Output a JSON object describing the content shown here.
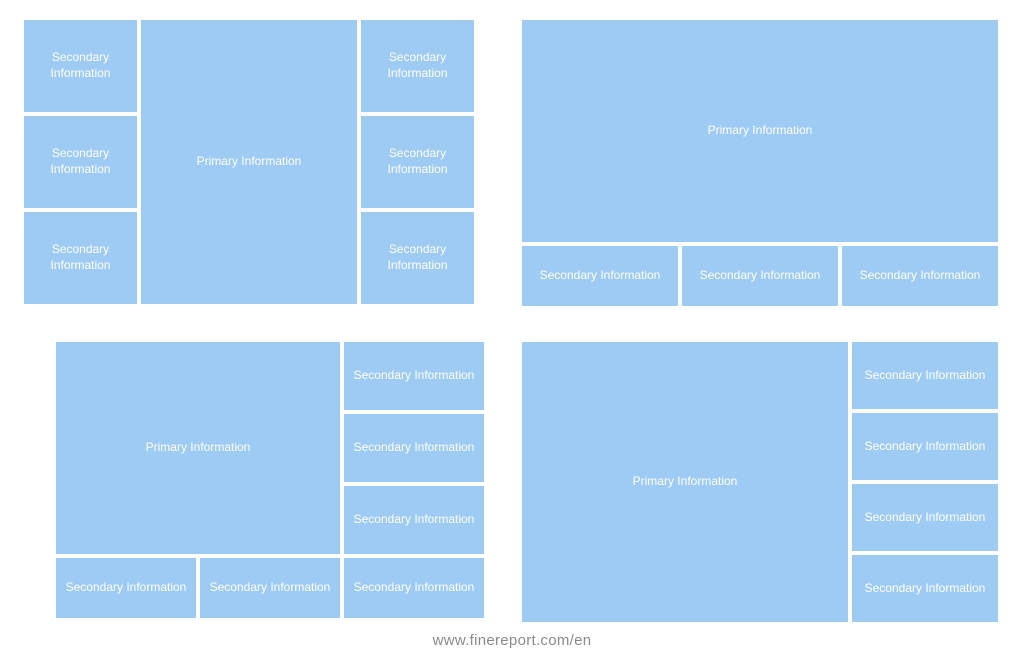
{
  "labels": {
    "primary": "Primary Information",
    "secondary": "Secondary Information"
  },
  "footer": "www.finereport.com/en",
  "colors": {
    "tile": "#9ecbf3",
    "text": "#ffffff"
  }
}
